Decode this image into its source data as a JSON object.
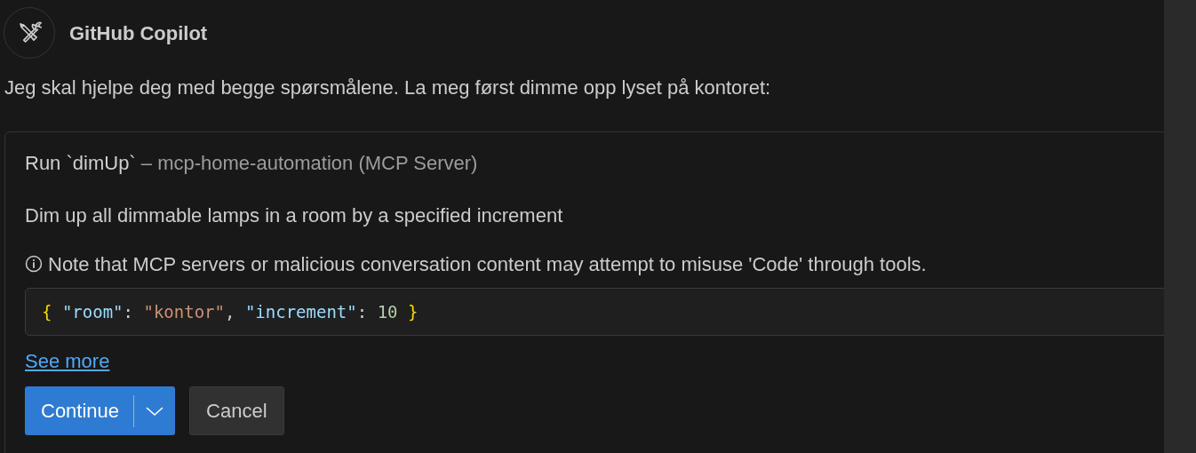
{
  "header": {
    "title": "GitHub Copilot"
  },
  "message": "Jeg skal hjelpe deg med begge spørsmålene. La meg først dimme opp lyset på kontoret:",
  "tool_card": {
    "title": "Run `dimUp`",
    "subtitle": "– mcp-home-automation (MCP Server)",
    "description": "Dim up all dimmable lamps in a room by a specified increment",
    "note": "Note that MCP servers or malicious conversation content may attempt to misuse 'Code' through tools.",
    "code_tokens": [
      {
        "kind": "brace",
        "text": "{"
      },
      {
        "kind": "key",
        "text": "\"room\""
      },
      {
        "kind": "punct",
        "text": ":"
      },
      {
        "kind": "string",
        "text": "\"kontor\""
      },
      {
        "kind": "punct",
        "text": ","
      },
      {
        "kind": "key",
        "text": "\"increment\""
      },
      {
        "kind": "punct",
        "text": ":"
      },
      {
        "kind": "number",
        "text": "10"
      },
      {
        "kind": "brace",
        "text": "}"
      }
    ],
    "link": "See more",
    "buttons": [
      {
        "kind": "primary",
        "label": "Continue"
      },
      {
        "kind": "secondary",
        "label": "Cancel"
      }
    ]
  }
}
